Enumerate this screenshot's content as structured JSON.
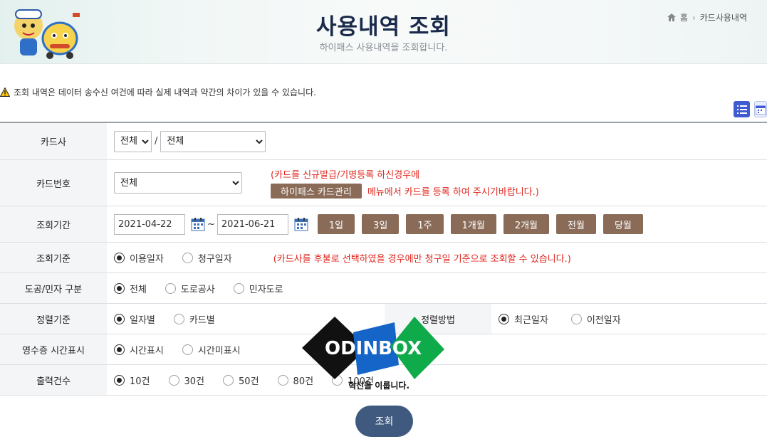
{
  "header": {
    "title": "사용내역 조회",
    "subtitle": "하이패스 사용내역을 조회합니다.",
    "breadcrumb": {
      "home": "홈",
      "current": "카드사용내역"
    }
  },
  "notice": "조회 내역은 데이터 송수신 여건에 따라 실제 내역과 약간의 차이가 있을 수 있습니다.",
  "form": {
    "card_company": {
      "label": "카드사",
      "select1": "전체",
      "select2": "전체",
      "slash": "/"
    },
    "card_number": {
      "label": "카드번호",
      "select": "전체",
      "msg1": "(카드를 신규발급/기명등록 하신경우에",
      "mgmt_button": "하이패스 카드관리",
      "msg2": "메뉴에서 카드를 등록 하여 주시기바랍니다.)"
    },
    "period": {
      "label": "조회기간",
      "start": "2021-04-22",
      "end": "2021-06-21",
      "tilde": "~",
      "buttons": [
        "1일",
        "3일",
        "1주",
        "1개월",
        "2개월",
        "전월",
        "당월"
      ]
    },
    "criteria": {
      "label": "조회기준",
      "options": [
        "이용일자",
        "청구일자"
      ],
      "selected": 0,
      "note": "(카드사를 후불로 선택하였을 경우에만 청구일 기준으로 조회할 수 있습니다.)"
    },
    "road_type": {
      "label": "도공/민자 구분",
      "options": [
        "전체",
        "도로공사",
        "민자도로"
      ],
      "selected": 0
    },
    "sort_basis": {
      "label": "정렬기준",
      "options": [
        "일자별",
        "카드별"
      ],
      "selected": 0
    },
    "sort_method": {
      "label": "정렬방법",
      "options": [
        "최근일자",
        "이전일자"
      ],
      "selected": 0
    },
    "receipt_time": {
      "label": "영수증 시간표시",
      "options": [
        "시간표시",
        "시간미표시"
      ],
      "selected": 0
    },
    "output_count": {
      "label": "출력건수",
      "options": [
        "10건",
        "30건",
        "50건",
        "80건",
        "100건"
      ],
      "selected": 0
    }
  },
  "search_button": "조회",
  "watermark": {
    "logo": "ODINBOX",
    "tagline": "혁신을 이룹니다."
  },
  "colors": {
    "brown_button": "#8a6b58",
    "search_button": "#3f5a7e",
    "warning_red": "#e0261d",
    "title": "#1b2a4a"
  }
}
